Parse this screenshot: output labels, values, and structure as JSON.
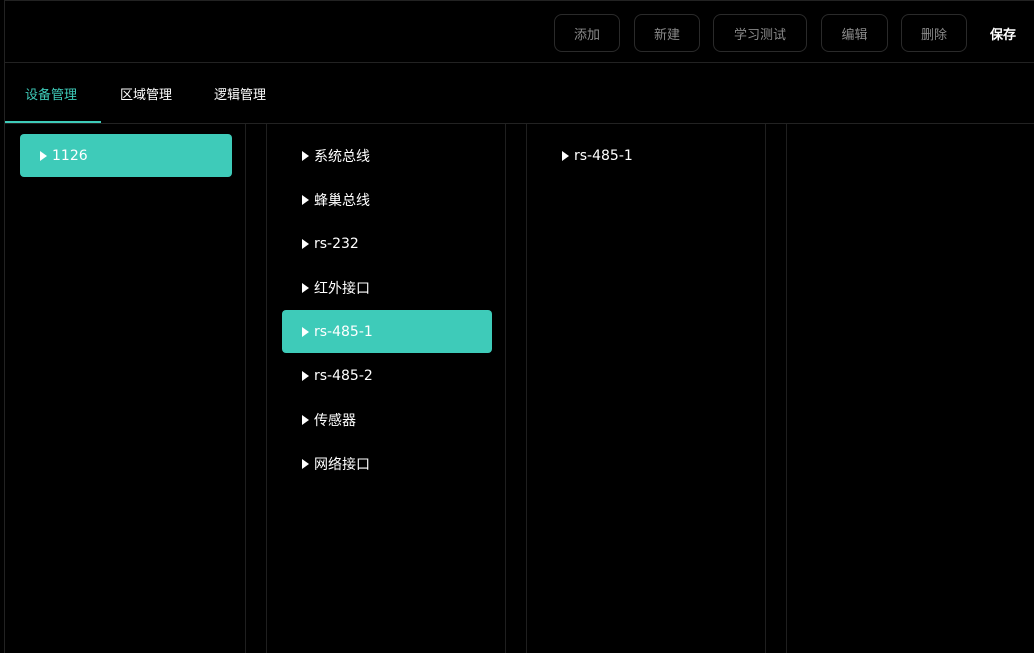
{
  "toolbar": {
    "add_label": "添加",
    "new_label": "新建",
    "learn_test_label": "学习测试",
    "edit_label": "编辑",
    "delete_label": "删除",
    "save_label": "保存"
  },
  "tabs": [
    {
      "label": "设备管理",
      "active": true
    },
    {
      "label": "区域管理",
      "active": false
    },
    {
      "label": "逻辑管理",
      "active": false
    }
  ],
  "column1": {
    "items": [
      {
        "label": "1126",
        "selected": true
      }
    ]
  },
  "column2": {
    "items": [
      {
        "label": "系统总线",
        "selected": false
      },
      {
        "label": "蜂巢总线",
        "selected": false
      },
      {
        "label": "rs-232",
        "selected": false
      },
      {
        "label": "红外接口",
        "selected": false
      },
      {
        "label": "rs-485-1",
        "selected": true
      },
      {
        "label": "rs-485-2",
        "selected": false
      },
      {
        "label": "传感器",
        "selected": false
      },
      {
        "label": "网络接口",
        "selected": false
      }
    ]
  },
  "column3": {
    "items": [
      {
        "label": "rs-485-1",
        "selected": false
      }
    ]
  },
  "colors": {
    "accent": "#3ecbb9",
    "background": "#000000",
    "border": "#222222",
    "muted_text": "#8a8a8a"
  }
}
